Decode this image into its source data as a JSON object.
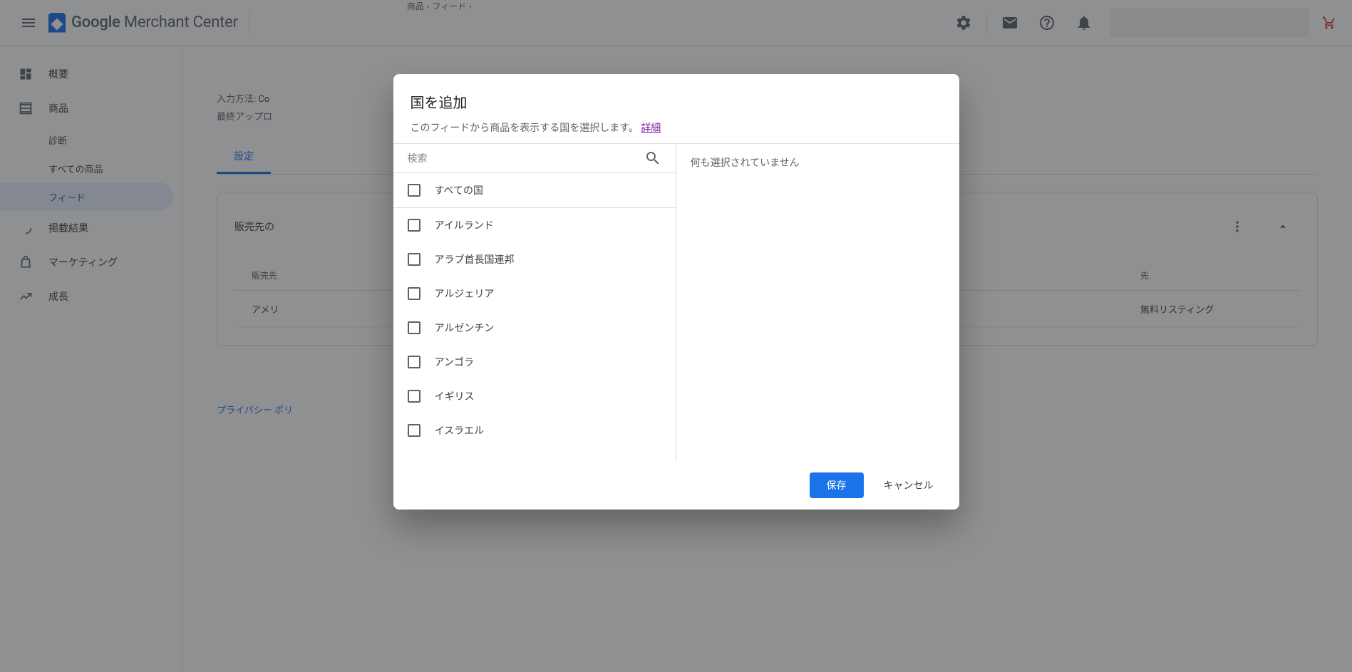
{
  "header": {
    "logo_text_bold": "Google",
    "logo_text_rest": " Merchant Center",
    "breadcrumb": [
      "商品",
      "フィード"
    ]
  },
  "sidebar": {
    "items": [
      {
        "icon": "dashboard",
        "label": "概要"
      },
      {
        "icon": "list",
        "label": "商品"
      },
      {
        "icon": "",
        "label": "診断",
        "sub": true
      },
      {
        "icon": "",
        "label": "すべての商品",
        "sub": true
      },
      {
        "icon": "",
        "label": "フィード",
        "sub": true,
        "active": true
      },
      {
        "icon": "circle",
        "label": "掲載結果"
      },
      {
        "icon": "bag",
        "label": "マーケティング"
      },
      {
        "icon": "trend",
        "label": "成長"
      }
    ]
  },
  "main": {
    "input_method_label": "入力方法:",
    "input_method_value": "Co",
    "last_upload_label": "最終アップロ",
    "tab_settings": "設定",
    "card_title": "販売先の",
    "col1_header": "販売先",
    "col2_header": "先",
    "row_country": "アメリ",
    "row_listing": "無料リスティング",
    "footer_link": "プライバシー ポリ"
  },
  "dialog": {
    "title": "国を追加",
    "desc": "このフィードから商品を表示する国を選択します。",
    "link": "詳細",
    "search_placeholder": "検索",
    "right_empty": "何も選択されていません",
    "all_label": "すべての国",
    "countries": [
      "アイルランド",
      "アラブ首長国連邦",
      "アルジェリア",
      "アルゼンチン",
      "アンゴラ",
      "イギリス",
      "イスラエル"
    ],
    "save": "保存",
    "cancel": "キャンセル"
  }
}
